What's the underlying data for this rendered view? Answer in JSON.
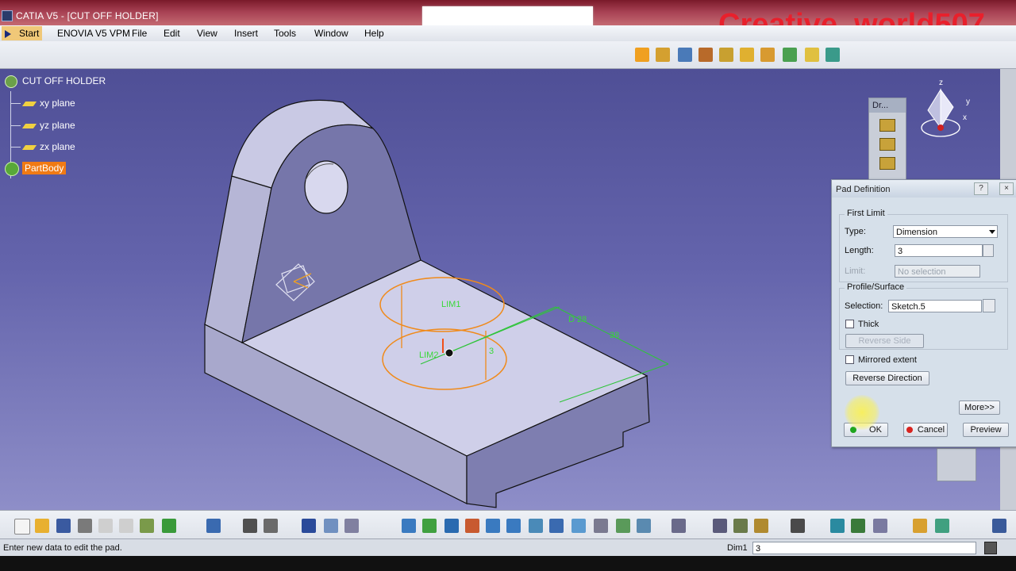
{
  "window": {
    "title": "CATIA V5 - [CUT OFF HOLDER]"
  },
  "watermark": "Creative_world507",
  "menu": {
    "items": [
      "Start",
      "ENOVIA V5 VPM",
      "File",
      "Edit",
      "View",
      "Insert",
      "Tools",
      "Window",
      "Help"
    ]
  },
  "tree": {
    "root": "CUT OFF HOLDER",
    "nodes": [
      "xy plane",
      "yz plane",
      "zx plane"
    ],
    "partbody": "PartBody"
  },
  "sketch_labels": {
    "lim1": "LIM1",
    "lim2": "LIM2",
    "d28": "D 28",
    "d38": "38",
    "h3": "3"
  },
  "compass": {
    "z": "z",
    "y": "y",
    "x": "x"
  },
  "float_toolbar": {
    "title": "Dr..."
  },
  "dialog": {
    "title": "Pad Definition",
    "help": "?",
    "close": "×",
    "first_limit": {
      "label": "First Limit",
      "type_label": "Type:",
      "type_value": "Dimension",
      "length_label": "Length:",
      "length_value": "3",
      "limit_label": "Limit:",
      "limit_value": "No selection"
    },
    "profile": {
      "label": "Profile/Surface",
      "selection_label": "Selection:",
      "selection_value": "Sketch.5",
      "thick_label": "Thick",
      "reverse_side": "Reverse Side"
    },
    "mirrored_label": "Mirrored extent",
    "reverse_direction": "Reverse Direction",
    "more": "More>>",
    "ok": "OK",
    "cancel": "Cancel",
    "preview": "Preview"
  },
  "status": {
    "message": "Enter new data to edit the pad.",
    "dim_label": "Dim1",
    "dim_value": "3"
  }
}
